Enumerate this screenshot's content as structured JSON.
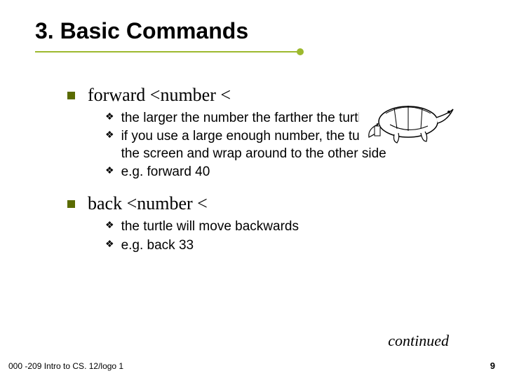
{
  "title": "3.  Basic Commands",
  "illustration": "turtle-drawing",
  "items": [
    {
      "label": "forward <number  <",
      "sub": [
        "the larger the number the farther the turtle will go",
        "if you use a large enough number, the turtle will walk off the screen and wrap around to the other side",
        "e.g. forward 40"
      ]
    },
    {
      "label": "back <number  <",
      "sub": [
        "the turtle will move backwards",
        "e.g. back 33"
      ]
    }
  ],
  "continued": "continued",
  "footer_left": "000 -209 Intro to CS. 12/logo 1",
  "page_number": "9"
}
